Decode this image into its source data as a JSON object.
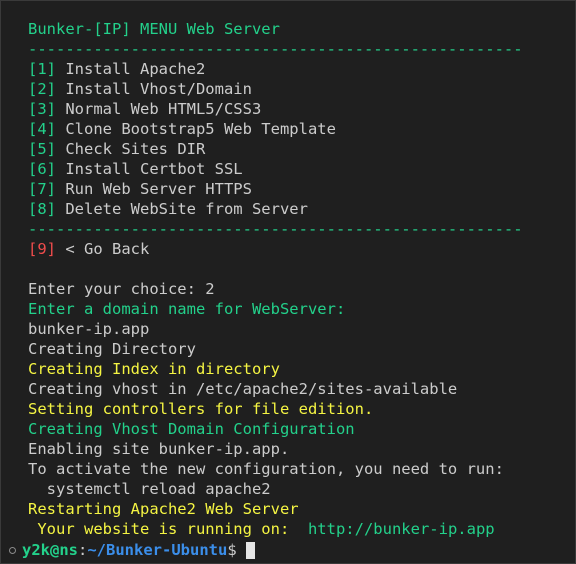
{
  "terminal": {
    "header_title": "Bunker-[IP] MENU Web Server",
    "separator": "-----------------------------------------------------",
    "menu": [
      {
        "num": "[1]",
        "label": " Install Apache2"
      },
      {
        "num": "[2]",
        "label": " Install Vhost/Domain"
      },
      {
        "num": "[3]",
        "label": " Normal Web HTML5/CSS3"
      },
      {
        "num": "[4]",
        "label": " Clone Bootstrap5 Web Template"
      },
      {
        "num": "[5]",
        "label": " Check Sites DIR"
      },
      {
        "num": "[6]",
        "label": " Install Certbot SSL"
      },
      {
        "num": "[7]",
        "label": " Run Web Server HTTPS"
      },
      {
        "num": "[8]",
        "label": " Delete WebSite from Server"
      }
    ],
    "back_item": {
      "num": "[9]",
      "label": " < Go Back"
    },
    "output": [
      "Enter your choice: 2",
      "Enter a domain name for WebServer:",
      "bunker-ip.app",
      "Creating Directory",
      "Creating Index in directory",
      "Creating vhost in /etc/apache2/sites-available",
      "Setting controllers for file edition.",
      "Creating Vhost Domain Configuration",
      "Enabling site bunker-ip.app.",
      "To activate the new configuration, you need to run:",
      "  systemctl reload apache2",
      "Restarting Apache2 Web Server"
    ],
    "running_label": " Your website is running on:  ",
    "running_url": "http://bunker-ip.app",
    "prompt": {
      "user_host": "y2k@ns",
      "separator": ":",
      "path": "~/Bunker-Ubuntu",
      "symbol": "$"
    }
  },
  "colors": {
    "background": "#1f1f1f",
    "green": "#23d18b",
    "red": "#f14c4c",
    "yellow": "#f5f543",
    "text": "#cccccc",
    "prompt_blue": "#3b8eea"
  }
}
